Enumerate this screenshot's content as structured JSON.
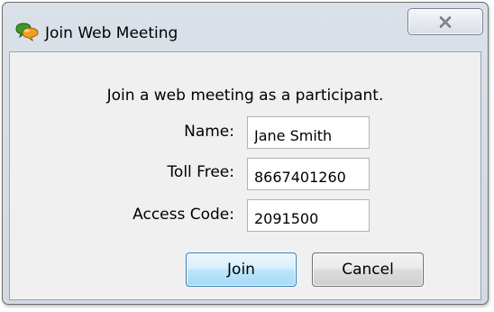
{
  "window": {
    "title": "Join Web Meeting",
    "icon": "chat-bubbles-icon",
    "close_icon": "close-icon"
  },
  "form": {
    "instruction": "Join a web meeting as a participant.",
    "fields": [
      {
        "label": "Name:",
        "value": "Jane Smith"
      },
      {
        "label": "Toll Free:",
        "value": "8667401260"
      },
      {
        "label": "Access Code:",
        "value": "2091500"
      }
    ]
  },
  "buttons": {
    "join_label": "Join",
    "cancel_label": "Cancel"
  },
  "colors": {
    "title_bar": "#d8dee6",
    "client_bg": "#f0f0f0",
    "default_button_border": "#3c7fb1"
  }
}
